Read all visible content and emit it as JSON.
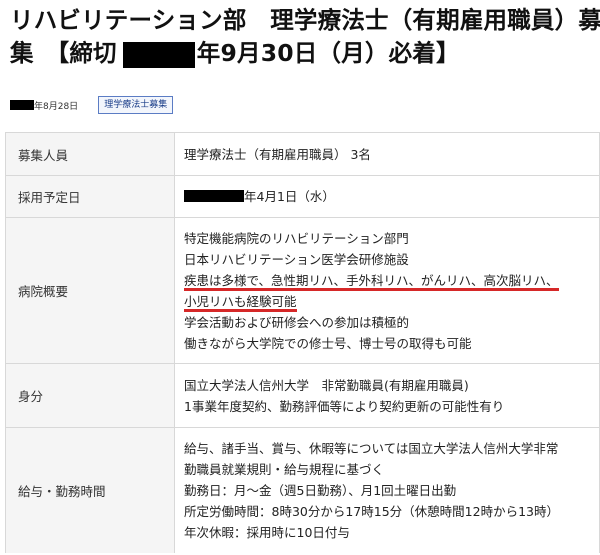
{
  "title": {
    "line1": "リハビリテーション部　理学療法士（有期雇用職員）募",
    "line2_prefix": "集　【締切",
    "line2_suffix": "年9月30日（月）必着】"
  },
  "meta": {
    "date_suffix": "年8月28日",
    "tag": "理学療法士募集"
  },
  "rows": [
    {
      "label": "募集人員",
      "lines": [
        "理学療法士（有期雇用職員） 3名"
      ]
    },
    {
      "label": "採用予定日",
      "date_suffix": "年4月1日（水）"
    },
    {
      "label": "病院概要",
      "lines": [
        "特定機能病院のリハビリテーション部門",
        "日本リハビリテーション医学会研修施設",
        "疾患は多様で、急性期リハ、手外科リハ、がんリハ、高次脳リハ、",
        "小児リハも経験可能",
        "学会活動および研修会への参加は積極的",
        "働きながら大学院での修士号、博士号の取得も可能"
      ]
    },
    {
      "label": "身分",
      "lines": [
        "国立大学法人信州大学　非常勤職員(有期雇用職員)",
        "1事業年度契約、勤務評価等により契約更新の可能性有り"
      ]
    },
    {
      "label": "給与・勤務時間",
      "lines": [
        "給与、諸手当、賞与、休暇等については国立大学法人信州大学非常",
        "勤職員就業規則・給与規程に基づく",
        "勤務日：月～金（週5日勤務）、月1回土曜日出勤",
        "所定労働時間：8時30分から17時15分（休憩時間12時から13時）",
        "年次休暇：採用時に10日付与"
      ]
    }
  ]
}
